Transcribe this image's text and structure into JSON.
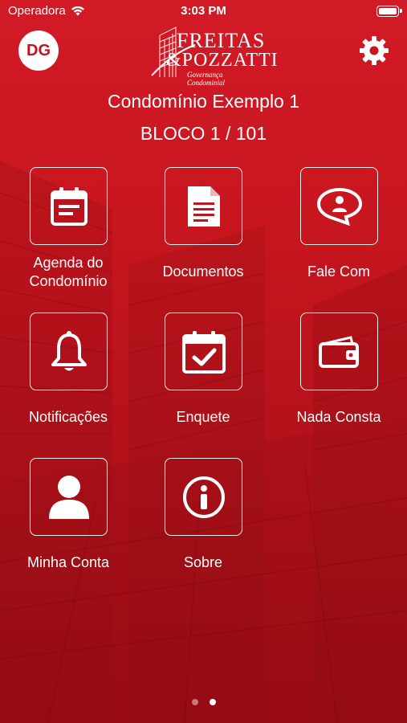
{
  "status_bar": {
    "carrier": "Operadora",
    "time": "3:03 PM"
  },
  "header": {
    "avatar_initials": "DG",
    "logo": {
      "line1": "FREITAS",
      "line2": "&POZZATTI",
      "subtitle": "Governança Condominial"
    },
    "settings_icon": "gear-icon"
  },
  "condominium": {
    "name": "Condomínio Exemplo 1",
    "unit": "BLOCO 1 / 101"
  },
  "menu": [
    {
      "label": "Agenda do Condomínio",
      "icon": "calendar-icon"
    },
    {
      "label": "Documentos",
      "icon": "document-icon"
    },
    {
      "label": "Fale Com",
      "icon": "chat-bubble-icon"
    },
    {
      "label": "Notificações",
      "icon": "bell-icon"
    },
    {
      "label": "Enquete",
      "icon": "calendar-check-icon"
    },
    {
      "label": "Nada Consta",
      "icon": "wallet-icon"
    },
    {
      "label": "Minha Conta",
      "icon": "user-icon"
    },
    {
      "label": "Sobre",
      "icon": "info-icon"
    }
  ],
  "page_indicator": {
    "pages": 2,
    "current": 2
  },
  "colors": {
    "background": "#c0141f",
    "foreground": "#ffffff"
  }
}
